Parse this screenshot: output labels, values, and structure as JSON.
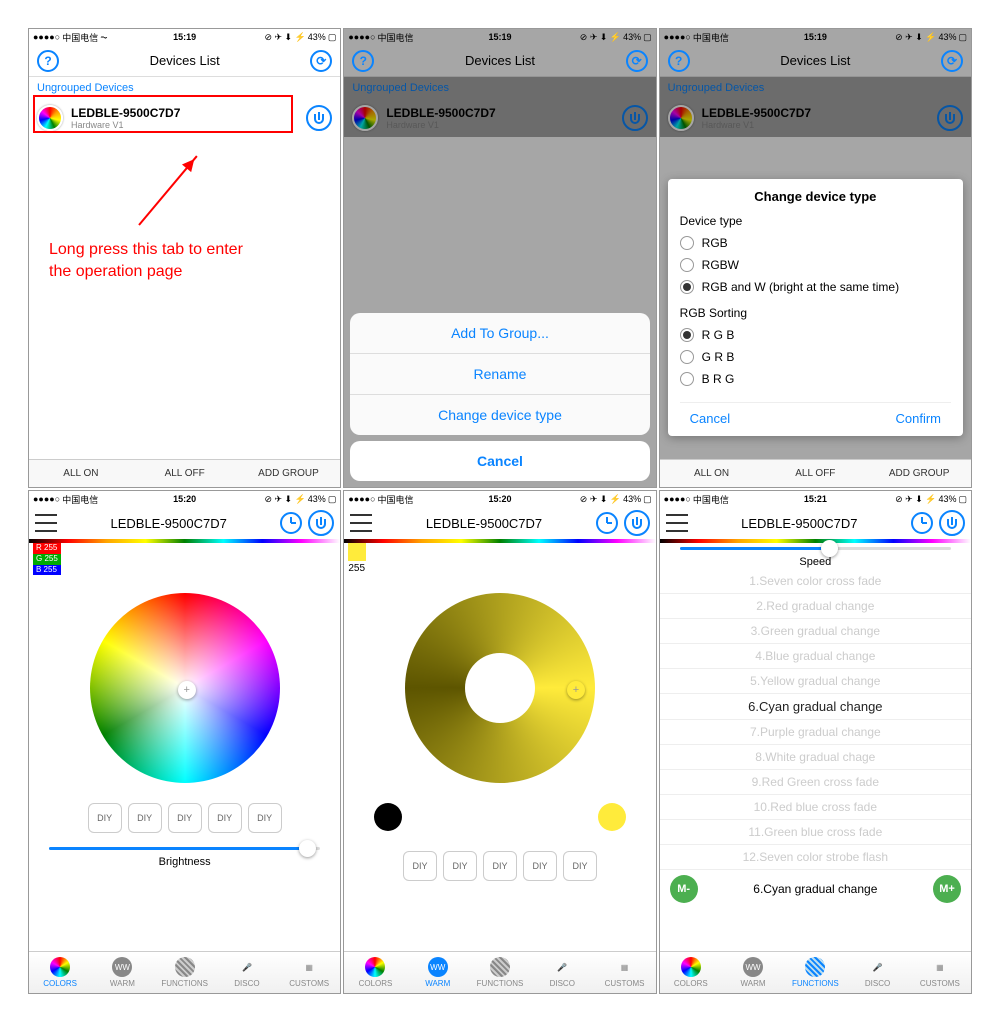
{
  "status": {
    "carrier": "中国电信",
    "time1": "15:19",
    "time2": "15:20",
    "time3": "15:21",
    "battery": "43%",
    "icons": "⊘ ✈ ⬇ ⚡"
  },
  "nav": {
    "title": "Devices List"
  },
  "section": "Ungrouped Devices",
  "device": {
    "name": "LEDBLE-9500C7D7",
    "sub": "Hardware V1"
  },
  "bottom": [
    "ALL ON",
    "ALL OFF",
    "ADD GROUP"
  ],
  "anno": "Long press this tab to enter\nthe operation page",
  "sheet": {
    "items": [
      "Add To Group...",
      "Rename",
      "Change device type"
    ],
    "cancel": "Cancel"
  },
  "modal": {
    "title": "Change device type",
    "typelabel": "Device type",
    "types": [
      "RGB",
      "RGBW",
      "RGB and W (bright at the same time)"
    ],
    "typesel": 2,
    "sortlabel": "RGB Sorting",
    "sorts": [
      "R G B",
      "G R B",
      "B R G"
    ],
    "sortsel": 0,
    "cancel": "Cancel",
    "confirm": "Confirm"
  },
  "ctrl": {
    "title": "LEDBLE-9500C7D7"
  },
  "rgb": {
    "r": "R 255",
    "g": "G 255",
    "b": "B 255"
  },
  "yellow": {
    "val": "255"
  },
  "diy": "DIY",
  "brightness": {
    "label": "Brightness",
    "pct": 95
  },
  "speed": {
    "label": "Speed",
    "pct": 55
  },
  "tabs": [
    "COLORS",
    "WARM",
    "FUNCTIONS",
    "DISCO",
    "CUSTOMS"
  ],
  "fns": [
    "1.Seven color cross fade",
    "2.Red  gradual change",
    "3.Green gradual change",
    "4.Blue gradual change",
    "5.Yellow gradual change",
    "6.Cyan gradual change",
    "7.Purple gradual change",
    "8.White gradual chage",
    "9.Red Green cross fade",
    "10.Red blue cross fade",
    "11.Green blue cross fade",
    "12.Seven color strobe flash"
  ],
  "fnsel": 5,
  "mminus": "M-",
  "mplus": "M+"
}
